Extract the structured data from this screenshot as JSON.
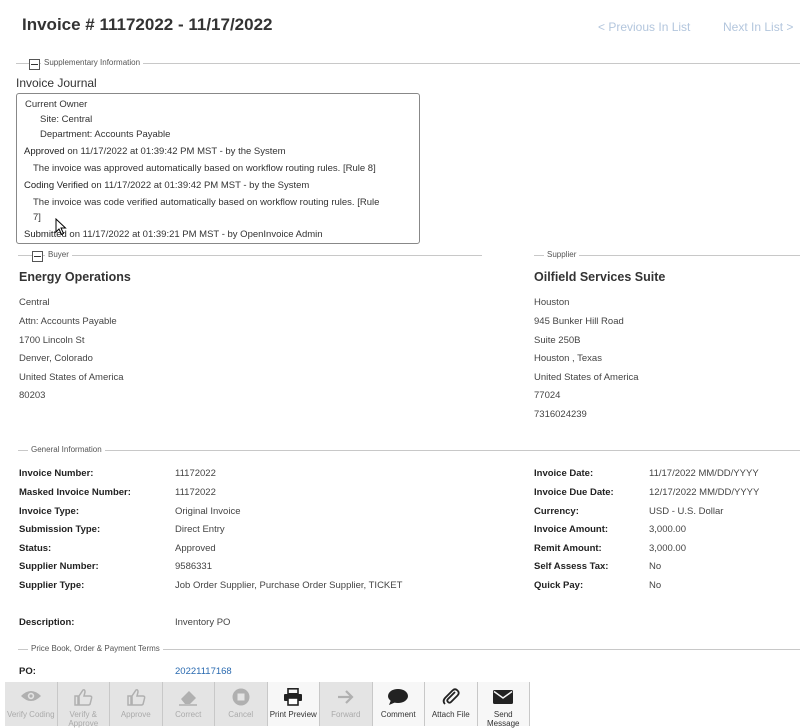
{
  "header": {
    "title": "Invoice # 11172022 - 11/17/2022",
    "prev_label": "< Previous In List",
    "next_label": "Next In List >"
  },
  "sections": {
    "supplementary": "Supplementary Information",
    "buyer": "Buyer",
    "supplier": "Supplier",
    "general": "General Information",
    "terms": "Price Book, Order & Payment Terms"
  },
  "journal": {
    "title": "Invoice Journal",
    "owner": "Current Owner",
    "site": "Site: Central",
    "department": "Department: Accounts Payable",
    "approved_action": "Approved",
    "approved_meta": "on 11/17/2022 at 01:39:42 PM MST - by the System",
    "approved_note": "The invoice was approved automatically based on workflow routing rules. [Rule 8]",
    "coding_action": "Coding Verified",
    "coding_meta": "on 11/17/2022 at 01:39:42 PM MST - by the System",
    "coding_note_1": "The invoice was code verified automatically based on workflow routing rules. [Rule",
    "coding_note_2": "7]",
    "submitted_action": "Submitted",
    "submitted_meta": "on 11/17/2022 at 01:39:21 PM MST - by OpenInvoice Admin"
  },
  "buyer": {
    "name": "Energy Operations",
    "lines": [
      "Central",
      "Attn:  Accounts Payable",
      "1700 Lincoln St",
      "Denver, Colorado",
      "United States of America",
      "80203"
    ]
  },
  "supplier": {
    "name": "Oilfield Services Suite",
    "lines": [
      "Houston",
      "945 Bunker Hill Road",
      "Suite 250B",
      "Houston ,  Texas",
      "United States of America",
      "77024",
      "7316024239"
    ]
  },
  "general_left": [
    {
      "label": "Invoice Number:",
      "value": "11172022"
    },
    {
      "label": "Masked Invoice Number:",
      "value": "11172022"
    },
    {
      "label": "Invoice Type:",
      "value": "Original Invoice"
    },
    {
      "label": "Submission Type:",
      "value": "Direct Entry"
    },
    {
      "label": "Status:",
      "value": "Approved"
    },
    {
      "label": "Supplier Number:",
      "value": "9586331"
    },
    {
      "label": "Supplier Type:",
      "value": "Job Order Supplier, Purchase Order Supplier, TICKET"
    }
  ],
  "description": {
    "label": "Description:",
    "value": "Inventory PO"
  },
  "general_right": [
    {
      "label": "Invoice Date:",
      "value": "11/17/2022  MM/DD/YYYY"
    },
    {
      "label": "Invoice Due Date:",
      "value": "12/17/2022  MM/DD/YYYY"
    },
    {
      "label": "Currency:",
      "value": "USD - U.S. Dollar"
    },
    {
      "label": "Invoice Amount:",
      "value": "3,000.00"
    },
    {
      "label": "Remit Amount:",
      "value": "3,000.00"
    },
    {
      "label": "Self Assess Tax:",
      "value": "No"
    },
    {
      "label": "Quick Pay:",
      "value": "No"
    }
  ],
  "po": {
    "label": "PO:",
    "value": "20221117168"
  },
  "toolbar": {
    "verify_coding": "Verify Coding",
    "verify_approve": "Verify & Approve",
    "approve": "Approve",
    "correct": "Correct",
    "cancel": "Cancel",
    "print_preview": "Print Preview",
    "forward": "Forward",
    "comment": "Comment",
    "attach_file": "Attach File",
    "send_message": "Send Message"
  },
  "colors": {
    "accent_link": "#2a6ab0",
    "disabled_nav": "#b3c6dd",
    "toolbar_bg": "#e4e4e4"
  }
}
